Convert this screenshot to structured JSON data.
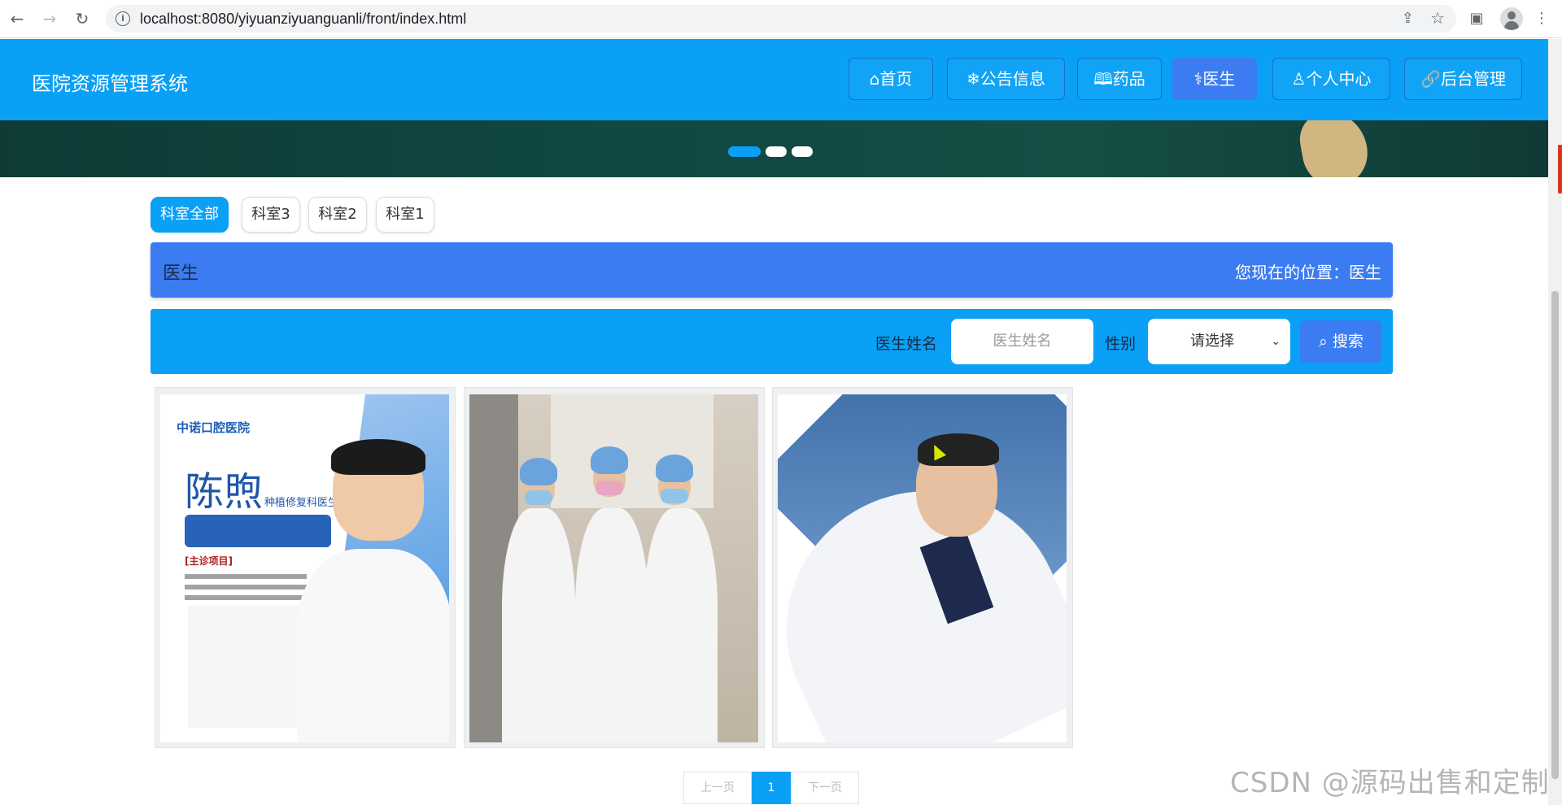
{
  "browser": {
    "url": "localhost:8080/yiyuanziyuanguanli/front/index.html",
    "back_icon": "back-arrow-icon",
    "forward_icon": "forward-arrow-icon",
    "reload_icon": "reload-icon"
  },
  "header": {
    "title": "医院资源管理系统",
    "nav": [
      {
        "label": "首页",
        "icon": "home-icon",
        "active": false
      },
      {
        "label": "公告信息",
        "icon": "snowflake-icon",
        "active": false
      },
      {
        "label": "药品",
        "icon": "book-icon",
        "active": false
      },
      {
        "label": "医生",
        "icon": "doctor-icon",
        "active": true
      },
      {
        "label": "个人中心",
        "icon": "user-icon",
        "active": false
      },
      {
        "label": "后台管理",
        "icon": "link-icon",
        "active": false
      }
    ]
  },
  "filters": [
    "科室全部",
    "科室3",
    "科室2",
    "科室1"
  ],
  "titlebar": {
    "title": "医生",
    "position_label": "您现在的位置：医生"
  },
  "search": {
    "name_label": "医生姓名",
    "name_placeholder": "医生姓名",
    "gender_label": "性别",
    "gender_value": "请选择",
    "search_button": "搜索"
  },
  "card1": {
    "logo": "中诺口腔医院",
    "name": "陈煦",
    "role": "种植修复科医生",
    "section": "[主诊项目]"
  },
  "pagination": {
    "prev": "上一页",
    "current": "1",
    "next": "下一页"
  },
  "watermark": "CSDN @源码出售和定制"
}
